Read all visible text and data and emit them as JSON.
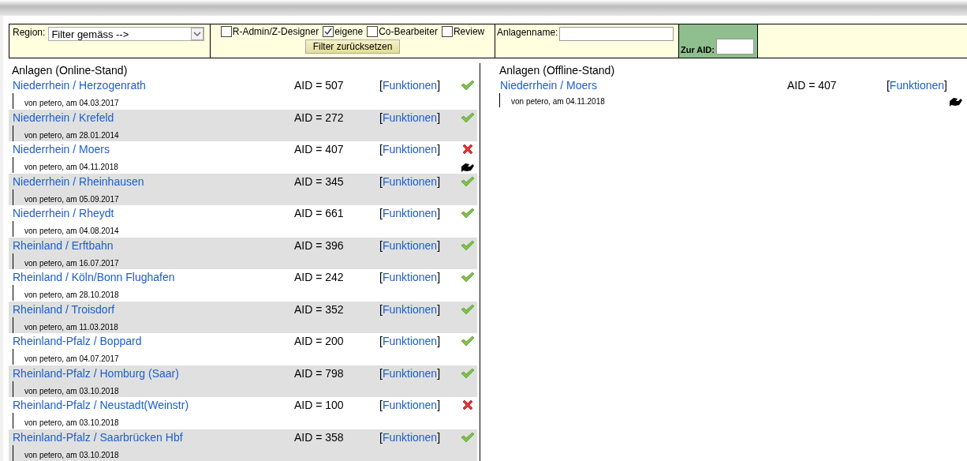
{
  "filter_bar": {
    "region": {
      "label": "Region:",
      "value": "Filter gemäss -->"
    },
    "checkboxes": [
      {
        "label": "R-Admin/Z-Designer",
        "checked": false
      },
      {
        "label": "eigene",
        "checked": true
      },
      {
        "label": "Co-Bearbeiter",
        "checked": false
      },
      {
        "label": "Review",
        "checked": false
      }
    ],
    "reset_button": "Filter zurücksetzen",
    "name_filter": {
      "label": "Anlagenname:"
    },
    "aid_filter": {
      "label": "Zur AID:"
    }
  },
  "online": {
    "title": "Anlagen (Online-Stand)",
    "rows": [
      {
        "name": "Niederrhein / Herzogenrath",
        "aid": "AID = 507",
        "functions": "[Funktionen]",
        "meta": "von petero, am 04.03.2017",
        "passed": true,
        "handshake": false
      },
      {
        "name": "Niederrhein / Krefeld",
        "aid": "AID = 272",
        "functions": "[Funktionen]",
        "meta": "von petero, am 28.01.2014",
        "passed": true,
        "handshake": false
      },
      {
        "name": "Niederrhein / Moers",
        "aid": "AID = 407",
        "functions": "[Funktionen]",
        "meta": "von petero, am 04.11.2018",
        "passed": false,
        "handshake": true
      },
      {
        "name": "Niederrhein / Rheinhausen",
        "aid": "AID = 345",
        "functions": "[Funktionen]",
        "meta": "von petero, am 05.09.2017",
        "passed": true,
        "handshake": false
      },
      {
        "name": "Niederrhein / Rheydt",
        "aid": "AID = 661",
        "functions": "[Funktionen]",
        "meta": "von petero, am 04.08.2014",
        "passed": true,
        "handshake": false
      },
      {
        "name": "Rheinland / Erftbahn",
        "aid": "AID = 396",
        "functions": "[Funktionen]",
        "meta": "von petero, am 16.07.2017",
        "passed": true,
        "handshake": false
      },
      {
        "name": "Rheinland / Köln/Bonn Flughafen",
        "aid": "AID = 242",
        "functions": "[Funktionen]",
        "meta": "von petero, am 28.10.2018",
        "passed": true,
        "handshake": false
      },
      {
        "name": "Rheinland / Troisdorf",
        "aid": "AID = 352",
        "functions": "[Funktionen]",
        "meta": "von petero, am 11.03.2018",
        "passed": true,
        "handshake": false
      },
      {
        "name": "Rheinland-Pfalz / Boppard",
        "aid": "AID = 200",
        "functions": "[Funktionen]",
        "meta": "von petero, am 04.07.2017",
        "passed": true,
        "handshake": false
      },
      {
        "name": "Rheinland-Pfalz / Homburg (Saar)",
        "aid": "AID = 798",
        "functions": "[Funktionen]",
        "meta": "von petero, am 03.10.2018",
        "passed": true,
        "handshake": false
      },
      {
        "name": "Rheinland-Pfalz / Neustadt(Weinstr)",
        "aid": "AID = 100",
        "functions": "[Funktionen]",
        "meta": "von petero, am 03.10.2018",
        "passed": false,
        "handshake": false
      },
      {
        "name": "Rheinland-Pfalz / Saarbrücken Hbf",
        "aid": "AID = 358",
        "functions": "[Funktionen]",
        "meta": "von petero, am 03.10.2018",
        "passed": true,
        "handshake": false
      }
    ]
  },
  "offline": {
    "title": "Anlagen (Offline-Stand)",
    "rows": [
      {
        "name": "Niederrhein / Moers",
        "aid": "AID = 407",
        "functions": "[Funktionen]",
        "meta": "von petero, am 04.11.2018",
        "handshake": true
      }
    ]
  }
}
